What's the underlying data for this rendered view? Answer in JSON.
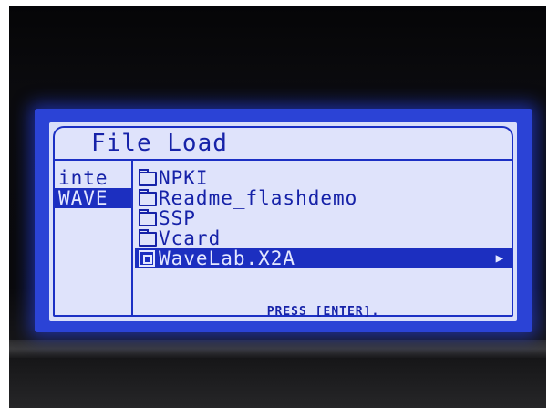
{
  "screen": {
    "title": "File Load",
    "tabs": [
      {
        "label": "inte",
        "selected": false
      },
      {
        "label": "WAVE",
        "selected": true
      }
    ],
    "files": [
      {
        "name": "NPKI",
        "type": "folder",
        "selected": false
      },
      {
        "name": "Readme_flashdemo",
        "type": "folder",
        "selected": false
      },
      {
        "name": "SSP",
        "type": "folder",
        "selected": false
      },
      {
        "name": "Vcard",
        "type": "folder",
        "selected": false
      },
      {
        "name": "WaveLab.X2A",
        "type": "file",
        "selected": true
      }
    ],
    "hint": "PRESS [ENTER].",
    "scroll_arrow": "▶"
  },
  "colors": {
    "lcd_background": "#dfe3fb",
    "lcd_text": "#1622a8",
    "highlight": "#1c2fc0",
    "backlight": "#2b43d6"
  }
}
